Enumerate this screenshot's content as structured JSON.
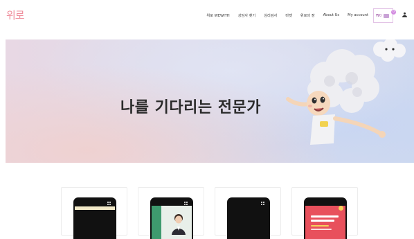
{
  "header": {
    "logo_text": "위로",
    "nav": [
      "위로 WEWITH",
      "상담사 찾기",
      "심리검사",
      "마켓",
      "위로의 장",
      "About Us",
      "My account"
    ],
    "cart": {
      "price": "₩0",
      "count": "0"
    },
    "icons": [
      "cart-icon",
      "user-icon"
    ]
  },
  "hero": {
    "title": "나를 기다리는 전문가",
    "image": "cloud-hair-mascot-illustration"
  },
  "cards": [
    {
      "image": "phone-screen-yellow-banner"
    },
    {
      "image": "phone-screen-counselor-portrait"
    },
    {
      "image": "phone-screen-dark"
    },
    {
      "image": "phone-screen-red-promo"
    }
  ],
  "colors": {
    "logo": "#ef8f9d",
    "accent": "#c9a2d6",
    "hero_text": "#2a2a2a"
  }
}
